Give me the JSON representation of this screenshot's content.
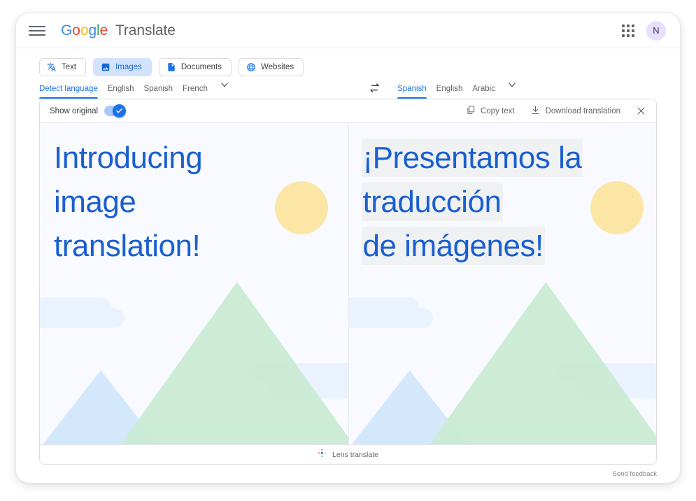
{
  "header": {
    "menu_icon": "hamburger-menu-icon",
    "logo_letters": [
      "G",
      "o",
      "o",
      "g",
      "l",
      "e"
    ],
    "product_name": "Translate",
    "apps_icon": "apps-grid-icon",
    "avatar_initial": "N"
  },
  "mode_tabs": [
    {
      "id": "text",
      "label": "Text",
      "icon": "translate-text-icon",
      "active": false
    },
    {
      "id": "images",
      "label": "Images",
      "icon": "image-icon",
      "active": true
    },
    {
      "id": "documents",
      "label": "Documents",
      "icon": "document-icon",
      "active": false
    },
    {
      "id": "websites",
      "label": "Websites",
      "icon": "globe-icon",
      "active": false
    }
  ],
  "source_languages": [
    {
      "label": "Detect language",
      "active": true
    },
    {
      "label": "English",
      "active": false
    },
    {
      "label": "Spanish",
      "active": false
    },
    {
      "label": "French",
      "active": false
    }
  ],
  "source_more_icon": "chevron-down-icon",
  "swap_icon": "swap-languages-icon",
  "target_languages": [
    {
      "label": "Spanish",
      "active": true
    },
    {
      "label": "English",
      "active": false
    },
    {
      "label": "Arabic",
      "active": false
    }
  ],
  "target_more_icon": "chevron-down-icon",
  "toolbar": {
    "show_original_label": "Show original",
    "show_original_on": true,
    "copy_text_label": "Copy text",
    "copy_icon": "copy-icon",
    "download_label": "Download translation",
    "download_icon": "download-icon",
    "close_icon": "close-icon"
  },
  "panes": {
    "original": {
      "lines": [
        "Introducing",
        "image",
        "translation!"
      ],
      "text_color": "#1a5fd0",
      "background": "#f8faff"
    },
    "translated": {
      "lines": [
        "¡Presentamos la",
        "traducción",
        "de imágenes!"
      ],
      "text_color": "#1a5fd0",
      "highlight_color": "#eff1f3",
      "background": "#f8faff"
    },
    "artwork": {
      "circle_color": "#fce6a6",
      "mountain_green": "#c9ebd3",
      "mountain_blue": "#d4e8fb",
      "cloud_color": "#eaf2fd"
    }
  },
  "lens_bar": {
    "icon": "google-lens-icon",
    "label": "Lens translate"
  },
  "feedback": {
    "label": "Send feedback"
  }
}
